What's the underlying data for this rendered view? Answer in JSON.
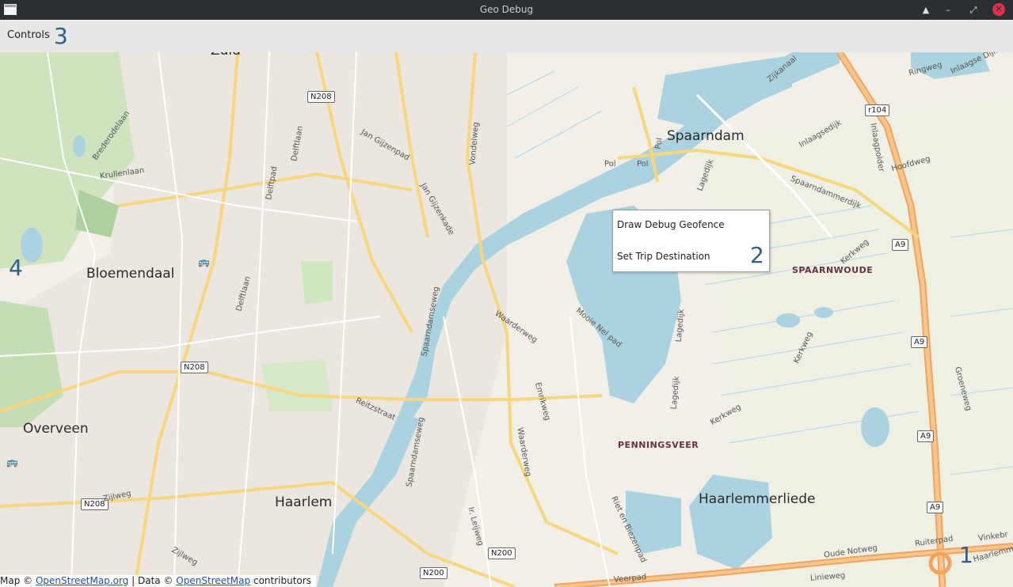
{
  "window": {
    "title": "Geo Debug"
  },
  "menubar": {
    "controls_label": "Controls"
  },
  "annotations": {
    "a1": "1",
    "a2": "2",
    "a3": "3",
    "a4": "4"
  },
  "context_menu": {
    "item1": "Draw Debug Geofence",
    "item2": "Set Trip Destination"
  },
  "map": {
    "towns": {
      "spaarndam": "Spaarndam",
      "bloemendaal": "Bloemendaal",
      "overveen": "Overveen",
      "haarlem": "Haarlem",
      "haarlemmerliede": "Haarlemmerliede",
      "zuid": "Zuid"
    },
    "villages": {
      "spaarnwoude": "SPAARNWOUDE",
      "penningsveer": "PENNINGSVEER"
    },
    "shields": {
      "n208a": "N208",
      "n208b": "N208",
      "n208c": "N208",
      "n200a": "N200",
      "n200b": "N200",
      "a9a": "A9",
      "a9b": "A9",
      "a9c": "A9",
      "a9d": "A9",
      "r104": "r104"
    },
    "streets": {
      "krullenlaan": "Kruⅼlenlaan",
      "bredero": "Brederodelaan",
      "delftpad": "Delftpad",
      "delftlaan": "Delftlaan",
      "delftlaan2": "Delftlaan",
      "gijzenpad": "Jan Gijzenpad",
      "gijzenkade": "Jan Gijzenkade",
      "vondelweg": "Vondelweg",
      "pol1": "Pol",
      "pol2": "Pol",
      "pol3": "Pol",
      "lagedijk1": "Lagedijk",
      "lagedijk2": "Lagedijk",
      "lagedijk3": "Lagedijk",
      "spaarndammerdijk": "Spaarndammerdijk",
      "inlaagsedijk": "Inlaagsedijk",
      "hoofdweg": "Hoofdweg",
      "ringweg": "Ringweg",
      "inlaagse": "Inlaagse Dijk",
      "inlaagpolder": "Inlaagpolder",
      "kerkweg1": "Kerkweg",
      "kerkweg2": "Kerkweg",
      "kerkweg3": "Kerkweg",
      "groeneweg": "Groeneweg",
      "mooie": "Mooie Nel pad",
      "waarderweg": "Waarderweg",
      "waarderweg2": "Waarderweg",
      "emrikweg": "Emrikweg",
      "spaarndamseweg": "Spaarndamseweg",
      "spaarndamseweg2": "Spaarndamseweg",
      "reitzstraat": "Reitzstraat",
      "zijlweg1": "Zijlweg",
      "zijlweg2": "Zijlweg",
      "leijweg": "Ir. Leijweg",
      "rietenbiezen": "Riet en Biezenpad",
      "oudenotweg": "Oude Notweg",
      "ruiterpad": "Ruiterpad",
      "vinkebr": "Vinkebr",
      "haarlemmer": "Haarlemmer",
      "linieweg": "Linieweg",
      "veerpad": "Veerpad",
      "zijkanaal": "Zijkanaal"
    }
  },
  "attribution": {
    "prefix": "Map ©",
    "osm1": "OpenStreetMap.org",
    "mid": "| Data ©",
    "osm2": "OpenStreetMap",
    "suffix": "contributors"
  }
}
